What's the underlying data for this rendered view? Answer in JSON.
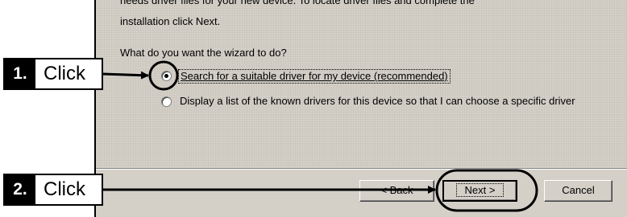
{
  "dialog": {
    "clipped_top_text": "needs driver files for your new device. To locate driver files and complete the",
    "install_text": "installation click Next.",
    "question": "What do you want the wizard to do?",
    "options": [
      {
        "label": "Search for a suitable driver for my device (recommended)",
        "selected": true
      },
      {
        "label": "Display a list of the known drivers for this device so that I can choose a specific driver",
        "selected": false
      }
    ],
    "buttons": {
      "back": "< Back",
      "next": "Next >",
      "cancel": "Cancel"
    }
  },
  "callouts": [
    {
      "number": "1.",
      "label": "Click"
    },
    {
      "number": "2.",
      "label": "Click"
    }
  ]
}
